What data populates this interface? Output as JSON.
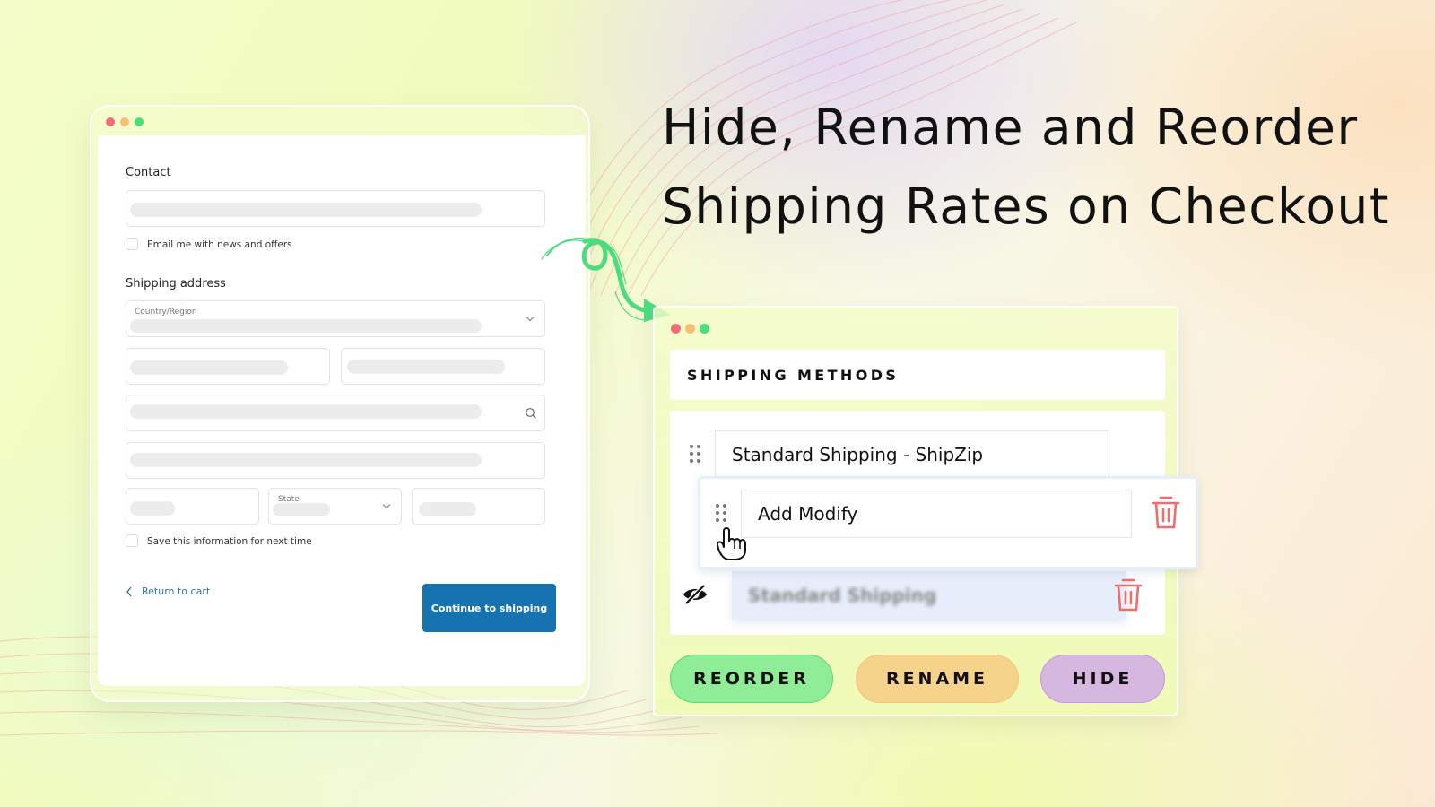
{
  "headline": {
    "line1": "Hide, Rename and Reorder",
    "line2": "Shipping Rates on Checkout"
  },
  "window_controls": {
    "colors": [
      "#f26d78",
      "#f5bf74",
      "#4fdc80"
    ]
  },
  "checkout": {
    "contact_heading": "Contact",
    "email_optin_label": "Email me with news and offers",
    "shipping_heading": "Shipping address",
    "country_label": "Country/Region",
    "state_label": "State",
    "save_info_label": "Save this information for next time",
    "return_link": "Return to cart",
    "continue_button": "Continue to shipping",
    "continue_button_color": "#1773b0",
    "link_color": "#2b74b0"
  },
  "shipping_methods": {
    "title": "SHIPPING METHODS",
    "rates": [
      {
        "name": "Standard Shipping - ShipZip",
        "state": "normal"
      },
      {
        "name": "Add Modify",
        "state": "dragging"
      },
      {
        "name": "Standard Shipping",
        "state": "hidden"
      }
    ],
    "trash_color": "#ef6d6d"
  },
  "actions": [
    {
      "label": "REORDER",
      "bg": "#8fec97",
      "border": "#5fd77a"
    },
    {
      "label": "RENAME",
      "bg": "#f6d38b",
      "border": "#f3c27d"
    },
    {
      "label": "HIDE",
      "bg": "#d6b7e0",
      "border": "#c497e2"
    }
  ],
  "arrow_color": "#4cdc7d"
}
